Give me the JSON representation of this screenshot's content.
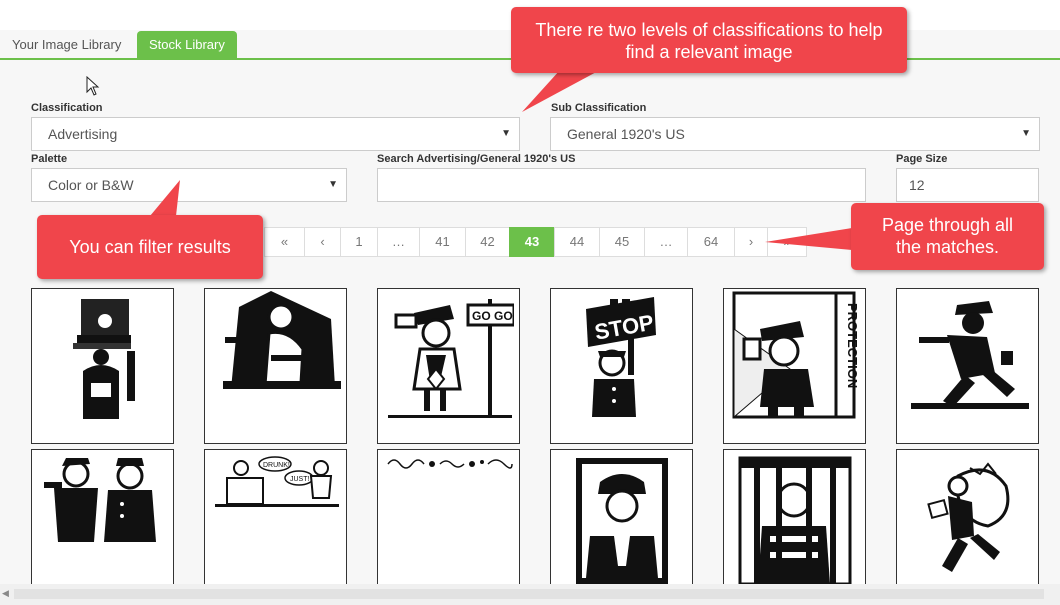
{
  "tabs": [
    {
      "label": "Your Image Library",
      "active": false
    },
    {
      "label": "Stock Library",
      "active": true
    }
  ],
  "filters": {
    "classification_label": "Classification",
    "classification_value": "Advertising",
    "sub_classification_label": "Sub Classification",
    "sub_classification_value": "General 1920's US",
    "palette_label": "Palette",
    "palette_value": "Color or B&W",
    "search_label": "Search Advertising/General 1920's US",
    "search_value": "",
    "page_size_label": "Page Size",
    "page_size_value": "12"
  },
  "pagination": {
    "first": "«",
    "prev": "‹",
    "pages": [
      "1",
      "…",
      "41",
      "42",
      "43",
      "44",
      "45",
      "…",
      "64"
    ],
    "current": "43",
    "next": "›",
    "last": "»"
  },
  "callouts": {
    "classifications": "There re two levels of classifications to help find a relevant image",
    "filter": "You can filter results",
    "paging": "Page through all the matches."
  },
  "colors": {
    "accent": "#6cc04a",
    "callout": "#f0454b"
  },
  "icons": {
    "dropdown": "caret-down-icon",
    "cursor": "mouse-pointer-icon"
  },
  "thumbnails": [
    {
      "subject": "crowd-silhouette"
    },
    {
      "subject": "man-with-gun"
    },
    {
      "subject": "traffic-officer-go-sign"
    },
    {
      "subject": "stop-sign-officer"
    },
    {
      "subject": "police-protection-sign"
    },
    {
      "subject": "running-gangster-with-gun"
    },
    {
      "subject": "policeman-and-robber"
    },
    {
      "subject": "drunk-just-cartoon"
    },
    {
      "subject": "border-ornament-strip"
    },
    {
      "subject": "fireman-portrait"
    },
    {
      "subject": "prisoner-behind-bars"
    },
    {
      "subject": "thief-with-money-bag"
    }
  ]
}
